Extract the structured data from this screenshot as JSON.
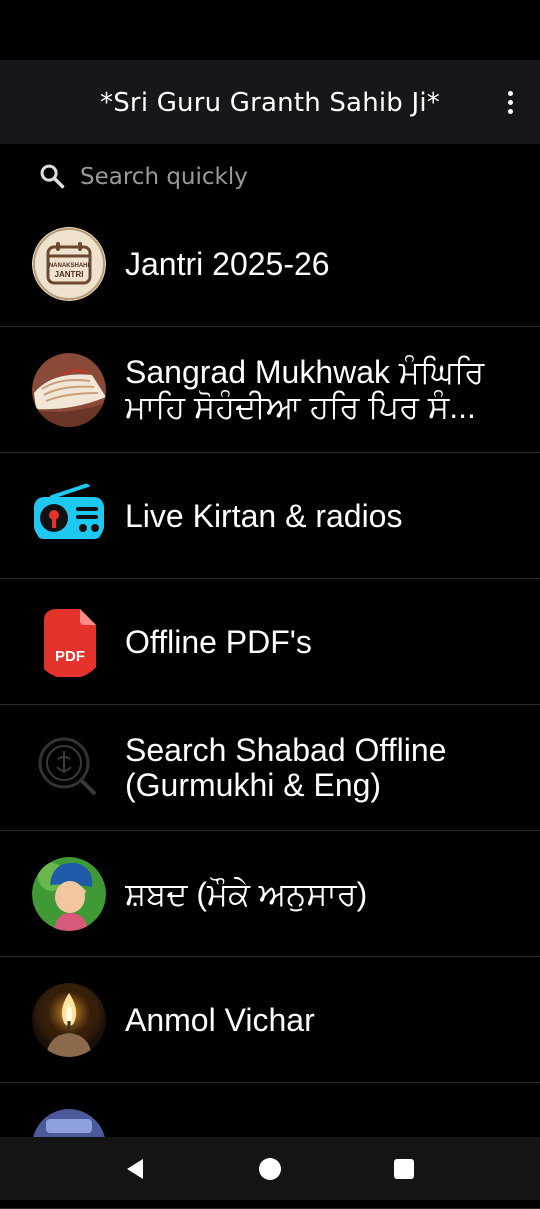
{
  "app_bar": {
    "title": "*Sri Guru Granth Sahib Ji*",
    "menu_icon": "more-vert-icon"
  },
  "search": {
    "icon": "search-icon",
    "placeholder": "Search quickly",
    "value": ""
  },
  "items": [
    {
      "label": "Jantri 2025-26",
      "icon": "nanakshahi-jantri-calendar-icon",
      "icon_text": [
        "NANAKSHAHI",
        "JANTRI"
      ]
    },
    {
      "label": "Sangrad Mukhwak ਮੰਘਿਰਿ ਮਾਹਿ ਸੋਹੰਦੀਆ ਹਰਿ ਪਿਰ ਸੰ...",
      "icon": "holy-scripture-page-icon"
    },
    {
      "label": "Live Kirtan & radios",
      "icon": "radio-icon"
    },
    {
      "label": "Offline PDF's",
      "icon": "pdf-file-icon",
      "icon_text": "PDF"
    },
    {
      "label": "Search Shabad Offline (Gurmukhi & Eng)",
      "icon": "khanda-search-icon"
    },
    {
      "label": "ਸ਼ਬਦ (ਮੌਕੇ ਅਨੁਸਾਰ)",
      "icon": "praying-child-icon"
    },
    {
      "label": "Anmol Vichar",
      "icon": "candle-flame-icon"
    },
    {
      "label": "",
      "icon": "partial-item-icon"
    }
  ],
  "nav_bar": {
    "back_icon": "back-triangle-icon",
    "home_icon": "home-circle-icon",
    "recents_icon": "recents-square-icon"
  },
  "colors": {
    "background": "#000000",
    "app_bar": "#17171b",
    "text": "#ffffff",
    "placeholder": "#9a9a9a",
    "divider": "#2a2a2a",
    "radio_cyan": "#1ec8f0",
    "pdf_red": "#e5322d"
  }
}
